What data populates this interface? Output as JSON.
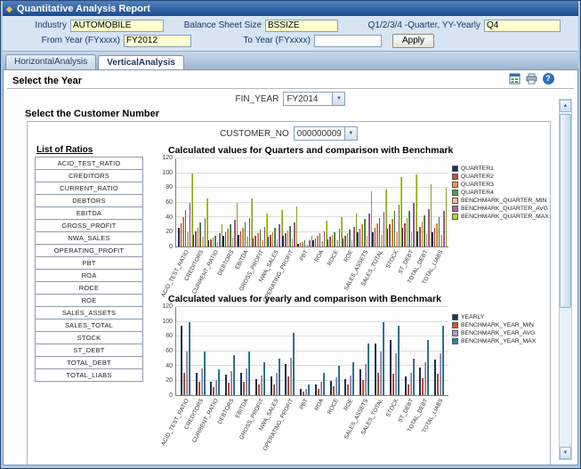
{
  "window": {
    "title": "Quantitative Analysis Report"
  },
  "colors": {
    "titlebar": "#1c4a8c",
    "field_yellow": "#ffffcf",
    "frame": "#aec6e0"
  },
  "form": {
    "industry_label": "Industry",
    "industry_value": "AUTOMOBILE",
    "balance_label": "Balance Sheet Size",
    "balance_value": "BSSIZE",
    "quarter_label": "Q1/2/3/4 -Quarter, YY-Yearly",
    "quarter_value": "Q4",
    "from_year_label": "From Year (FYxxxx)",
    "from_year_value": "FY2012",
    "to_year_label": "To Year (FYxxxx)",
    "to_year_value": "",
    "apply_label": "Apply"
  },
  "tabs": [
    {
      "label": "HorizontalAnalysis",
      "active": false
    },
    {
      "label": "VerticalAnalysis",
      "active": true
    }
  ],
  "toolbar": {
    "icons": [
      "export-icon",
      "print-icon",
      "help-icon"
    ]
  },
  "content": {
    "select_year_label": "Select the Year",
    "fin_year_label": "FIN_YEAR",
    "fin_year_value": "FY2014",
    "select_customer_label": "Select the Customer Number",
    "customer_no_label": "CUSTOMER_NO",
    "customer_no_value": "000000009",
    "ratios_header": "List of Ratios",
    "ratios": [
      "ACID_TEST_RATIO",
      "CREDITORS",
      "CURRENT_RATIO",
      "DEBTORS",
      "EBITDA",
      "GROSS_PROFIT",
      "NWA_SALES",
      "OPERATING_PROFIT",
      "PBT",
      "ROA",
      "ROCE",
      "ROE",
      "SALES_ASSETS",
      "SALES_TOTAL",
      "STOCK",
      "ST_DEBT",
      "TOTAL_DEBT",
      "TOTAL_LIABS"
    ]
  },
  "chart_data": [
    {
      "type": "bar",
      "title": "Calculated values for Quarters and comparison with Benchmark",
      "xlabel": "",
      "ylabel": "",
      "ylim": [
        0,
        120
      ],
      "yticks": [
        0,
        20,
        40,
        60,
        80,
        100,
        120
      ],
      "grid": true,
      "legend_position": "right",
      "categories": [
        "ACID_TEST_RATIO",
        "CREDITORS",
        "CURRENT_RATIO",
        "DEBTORS",
        "EBITDA",
        "GROSS_PROFIT",
        "NWA_SALES",
        "OPERATING_PROFIT",
        "PBT",
        "ROA",
        "ROCE",
        "ROE",
        "SALES_ASSETS",
        "SALES_TOTAL",
        "STOCK",
        "ST_DEBT",
        "TOTAL_DEBT",
        "TOTAL_LIABS"
      ],
      "series": [
        {
          "name": "QUARTER1",
          "color": "#17375e",
          "values": [
            25,
            16,
            8,
            15,
            16,
            11,
            13,
            14,
            4,
            9,
            10,
            11,
            19,
            20,
            24,
            25,
            21,
            20
          ]
        },
        {
          "name": "QUARTER2",
          "color": "#c0504d",
          "values": [
            32,
            21,
            10,
            19,
            21,
            14,
            16,
            18,
            5,
            11,
            13,
            14,
            24,
            25,
            30,
            31,
            27,
            26
          ]
        },
        {
          "name": "QUARTER3",
          "color": "#f79646",
          "values": [
            40,
            26,
            12,
            24,
            26,
            18,
            20,
            22,
            6,
            14,
            16,
            18,
            30,
            31,
            38,
            39,
            34,
            32
          ]
        },
        {
          "name": "QUARTER4",
          "color": "#4f9d4f",
          "values": [
            50,
            33,
            15,
            30,
            33,
            23,
            25,
            28,
            8,
            18,
            20,
            23,
            38,
            39,
            48,
            49,
            43,
            40
          ]
        },
        {
          "name": "BENCHMARK_QUARTER_MIN",
          "color": "#fac08f",
          "values": [
            20,
            13,
            6,
            12,
            13,
            9,
            10,
            11,
            3,
            7,
            8,
            9,
            15,
            16,
            19,
            20,
            17,
            16
          ]
        },
        {
          "name": "BENCHMARK_QUARTER_AVG",
          "color": "#b162a6",
          "values": [
            60,
            39,
            18,
            36,
            39,
            27,
            30,
            33,
            9,
            21,
            24,
            27,
            45,
            47,
            57,
            59,
            51,
            48
          ]
        },
        {
          "name": "BENCHMARK_QUARTER_MAX",
          "color": "#b6d727",
          "values": [
            100,
            65,
            30,
            60,
            65,
            45,
            50,
            55,
            15,
            35,
            40,
            45,
            75,
            78,
            95,
            98,
            85,
            80
          ]
        }
      ]
    },
    {
      "type": "bar",
      "title": "Calculated values for yearly and comparison with Benchmark",
      "xlabel": "",
      "ylabel": "",
      "ylim": [
        0,
        120
      ],
      "yticks": [
        0,
        20,
        40,
        60,
        80,
        100,
        120
      ],
      "grid": true,
      "legend_position": "right",
      "categories": [
        "ACID_TEST_RATIO",
        "CREDITORS",
        "CURRENT_RATIO",
        "DEBTORS",
        "EBITDA",
        "GROSS_PROFIT",
        "NWA_SALES",
        "OPERATING_PROFIT",
        "PBT",
        "ROA",
        "ROCE",
        "ROE",
        "SALES_ASSETS",
        "SALES_TOTAL",
        "STOCK",
        "ST_DEBT",
        "TOTAL_DEBT",
        "TOTAL_LIABS"
      ],
      "series": [
        {
          "name": "YEARLY",
          "color": "#17375e",
          "values": [
            95,
            30,
            18,
            28,
            30,
            22,
            25,
            42,
            8,
            15,
            20,
            22,
            35,
            70,
            75,
            25,
            38,
            48
          ]
        },
        {
          "name": "BENCHMARK_YEAR_MIN",
          "color": "#d2552f",
          "values": [
            30,
            18,
            11,
            17,
            18,
            14,
            15,
            26,
            5,
            9,
            12,
            14,
            21,
            30,
            29,
            15,
            23,
            29
          ]
        },
        {
          "name": "BENCHMARK_YEAR_AVG",
          "color": "#b3a2c7",
          "values": [
            60,
            36,
            21,
            33,
            36,
            27,
            30,
            51,
            9,
            18,
            24,
            27,
            42,
            60,
            57,
            30,
            45,
            57
          ]
        },
        {
          "name": "BENCHMARK_YEAR_MAX",
          "color": "#31869b",
          "values": [
            100,
            60,
            35,
            55,
            60,
            45,
            50,
            85,
            15,
            30,
            40,
            45,
            70,
            100,
            95,
            50,
            75,
            95
          ]
        }
      ]
    }
  ]
}
